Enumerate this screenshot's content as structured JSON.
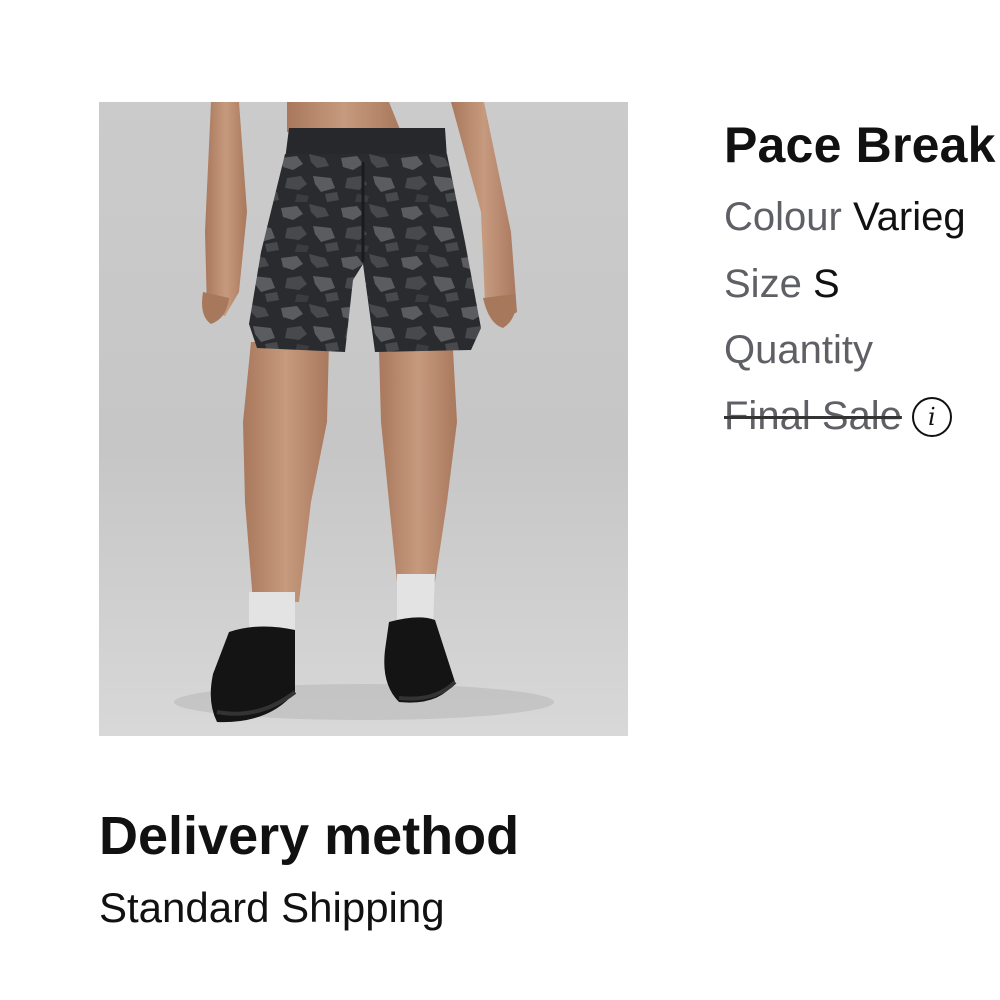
{
  "product": {
    "name": "Pace Break",
    "colour_label": "Colour",
    "colour_value": "Varieg",
    "size_label": "Size",
    "size_value": "S",
    "quantity_label": "Quantity",
    "final_sale_label": "Final Sale",
    "info_icon": "info-circle-icon",
    "image_alt": "Camo print men's shorts worn with white socks and black sneakers"
  },
  "delivery": {
    "heading": "Delivery method",
    "method": "Standard Shipping"
  },
  "colors": {
    "text_primary": "#111111",
    "text_secondary": "#5f6066",
    "image_background": "#c9c9c9"
  }
}
